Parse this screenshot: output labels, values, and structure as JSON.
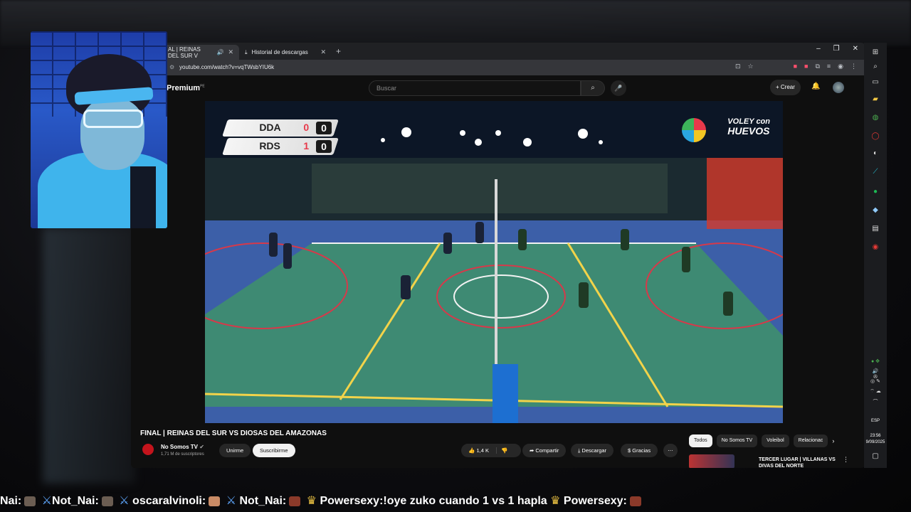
{
  "browser": {
    "tabs": [
      {
        "label": "AL | REINAS DEL SUR V"
      },
      {
        "label": "Historial de descargas"
      }
    ],
    "url": "youtube.com/watch?v=vqTWsbYIU6k"
  },
  "youtube": {
    "logo": "Premium",
    "logo_region": "PE",
    "search_placeholder": "Buscar",
    "create_label": "Crear"
  },
  "video": {
    "scoreboard": [
      {
        "team": "DDA",
        "sets": "0",
        "points": "0"
      },
      {
        "team": "RDS",
        "sets": "1",
        "points": "0"
      }
    ],
    "overlay_logo_line1": "VOLEY con",
    "overlay_logo_line2": "HUEVOS",
    "title": "FINAL | REINAS DEL SUR VS DIOSAS DEL AMAZONAS",
    "channel": "No Somos TV",
    "subscribers": "1,71 M de suscriptores",
    "join_label": "Unirme",
    "subscribe_label": "Suscribirme",
    "likes": "1,4 K",
    "share_label": "Compartir",
    "download_label": "Descargar",
    "thanks_label": "Gracias"
  },
  "related": {
    "chips": [
      "Todos",
      "No Somos TV",
      "Voleibol",
      "Relacionac"
    ],
    "first_title": "TERCER LUGAR | VILLANAS VS DIVAS DEL NORTE"
  },
  "taskbar": {
    "lang": "ESP",
    "time": "23:56",
    "date": "9/09/2025"
  },
  "chat": [
    {
      "name": "Nai:"
    },
    {
      "name": "Not_Nai:"
    },
    {
      "name": "oscaralvinoli:"
    },
    {
      "name": "Not_Nai:"
    },
    {
      "name": "Powersexy:",
      "message": "!oye zuko cuando 1 vs 1 hapla"
    },
    {
      "name": "Powersexy:"
    }
  ]
}
